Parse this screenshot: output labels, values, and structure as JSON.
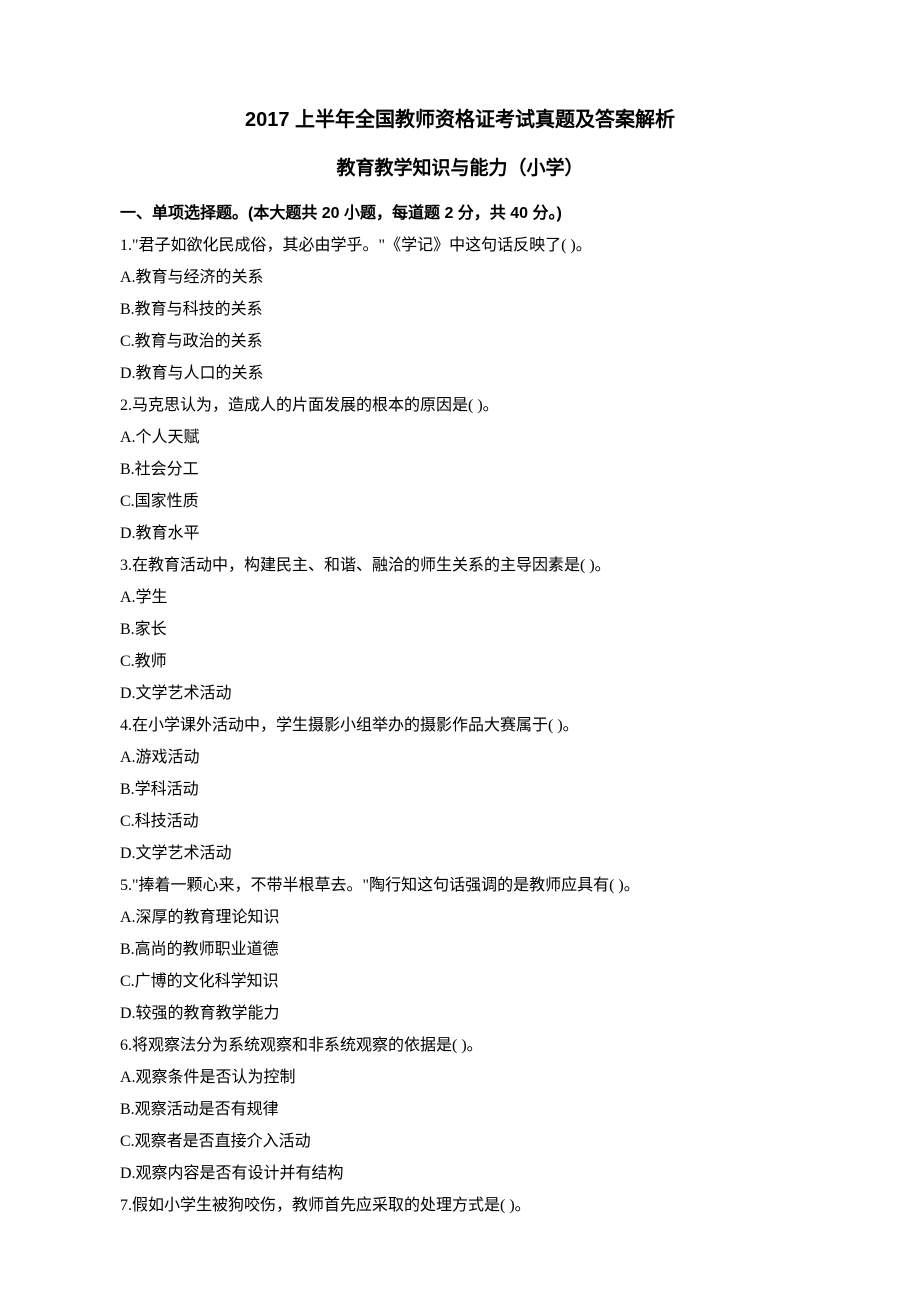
{
  "title": "2017 上半年全国教师资格证考试真题及答案解析",
  "subtitle": "教育教学知识与能力（小学）",
  "section_header": "一、单项选择题。(本大题共 20 小题，每道题 2 分，共 40 分。)",
  "questions": [
    {
      "stem": "1.\"君子如欲化民成俗，其必由学乎。\"《学记》中这句话反映了(  )。",
      "options": [
        "A.教育与经济的关系",
        "B.教育与科技的关系",
        "C.教育与政治的关系",
        "D.教育与人口的关系"
      ]
    },
    {
      "stem": "2.马克思认为，造成人的片面发展的根本的原因是(  )。",
      "options": [
        "A.个人天赋",
        "B.社会分工",
        "C.国家性质",
        "D.教育水平"
      ]
    },
    {
      "stem": "3.在教育活动中，构建民主、和谐、融洽的师生关系的主导因素是(  )。",
      "options": [
        "A.学生",
        "B.家长",
        "C.教师",
        "D.文学艺术活动"
      ]
    },
    {
      "stem": "4.在小学课外活动中，学生摄影小组举办的摄影作品大赛属于(  )。",
      "options": [
        "A.游戏活动",
        "B.学科活动",
        "C.科技活动",
        "D.文学艺术活动"
      ]
    },
    {
      "stem": "5.\"捧着一颗心来，不带半根草去。\"陶行知这句话强调的是教师应具有(  )。",
      "options": [
        "A.深厚的教育理论知识",
        "B.高尚的教师职业道德",
        "C.广博的文化科学知识",
        "D.较强的教育教学能力"
      ]
    },
    {
      "stem": "6.将观察法分为系统观察和非系统观察的依据是(  )。",
      "options": [
        "A.观察条件是否认为控制",
        "B.观察活动是否有规律",
        "C.观察者是否直接介入活动",
        "D.观察内容是否有设计并有结构"
      ]
    },
    {
      "stem": "7.假如小学生被狗咬伤，教师首先应采取的处理方式是(  )。",
      "options": []
    }
  ]
}
